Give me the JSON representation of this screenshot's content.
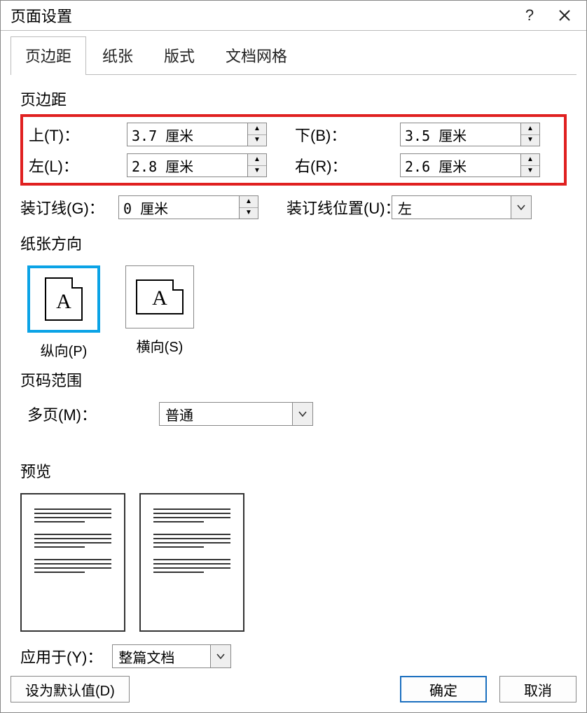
{
  "title": "页面设置",
  "tabs": {
    "margins": "页边距",
    "paper": "纸张",
    "layout": "版式",
    "grid": "文档网格"
  },
  "active_tab": "margins",
  "margins_section_title": "页边距",
  "margins": {
    "top_label": "上(T)：",
    "top_value": "3.7 厘米",
    "bottom_label": "下(B)：",
    "bottom_value": "3.5 厘米",
    "left_label": "左(L)：",
    "left_value": "2.8 厘米",
    "right_label": "右(R)：",
    "right_value": "2.6 厘米"
  },
  "gutter": {
    "size_label": "装订线(G)：",
    "size_value": "0 厘米",
    "pos_label": "装订线位置(U)：",
    "pos_value": "左"
  },
  "orientation_section_title": "纸张方向",
  "orientation": {
    "portrait_label": "纵向(P)",
    "landscape_label": "横向(S)",
    "selected": "portrait"
  },
  "pages_section_title": "页码范围",
  "pages": {
    "multi_label": "多页(M)：",
    "multi_value": "普通"
  },
  "preview_title": "预览",
  "apply_to": {
    "label": "应用于(Y)：",
    "value": "整篇文档"
  },
  "buttons": {
    "set_default": "设为默认值(D)",
    "ok": "确定",
    "cancel": "取消"
  }
}
